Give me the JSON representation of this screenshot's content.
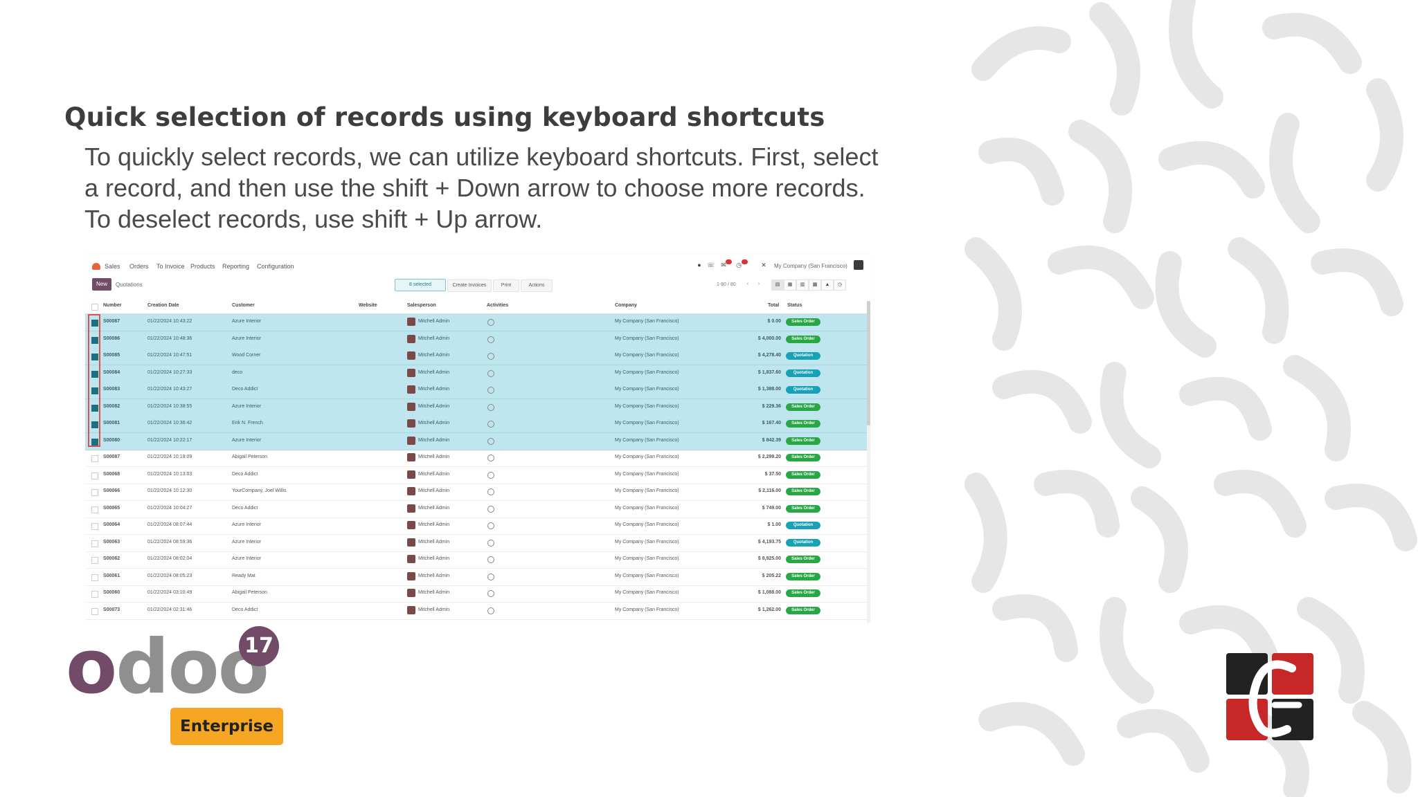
{
  "slide": {
    "title": "Quick selection of records using keyboard shortcuts",
    "body_lines": [
      "To quickly select records, we can utilize keyboard shortcuts. First, select",
      "a record, and then use the shift + Down arrow to choose more records.",
      "To deselect records, use shift + Up arrow."
    ]
  },
  "app": {
    "menu": [
      "Sales",
      "Orders",
      "To Invoice",
      "Products",
      "Reporting",
      "Configuration"
    ],
    "company": "My Company (San Francisco)",
    "new_button": "New",
    "breadcrumb": "Quotations",
    "selected_chip": "8 selected",
    "actions": [
      "Create Invoices",
      "Print",
      "Actions"
    ],
    "pager": "1-80 / 80",
    "columns": [
      "Number",
      "Creation Date",
      "Customer",
      "Website",
      "Salesperson",
      "Activities",
      "Company",
      "Total",
      "Status"
    ],
    "rows": [
      {
        "number": "S00087",
        "date": "01/22/2024 10:43:22",
        "customer": "Azure Interior",
        "salesperson": "Mitchell Admin",
        "company": "My Company (San Francisco)",
        "total": "$ 0.00",
        "status": "Sales Order",
        "status_type": "so",
        "selected": true
      },
      {
        "number": "S00086",
        "date": "01/22/2024 10:48:36",
        "customer": "Azure Interior",
        "salesperson": "Mitchell Admin",
        "company": "My Company (San Francisco)",
        "total": "$ 4,000.00",
        "status": "Sales Order",
        "status_type": "so",
        "selected": true
      },
      {
        "number": "S00085",
        "date": "01/22/2024 10:47:51",
        "customer": "Wood Corner",
        "salesperson": "Mitchell Admin",
        "company": "My Company (San Francisco)",
        "total": "$ 4,278.40",
        "status": "Quotation",
        "status_type": "q",
        "selected": true
      },
      {
        "number": "S00084",
        "date": "01/22/2024 10:27:33",
        "customer": "deco",
        "salesperson": "Mitchell Admin",
        "company": "My Company (San Francisco)",
        "total": "$ 1,837.60",
        "status": "Quotation",
        "status_type": "q",
        "selected": true
      },
      {
        "number": "S00083",
        "date": "01/22/2024 10:43:27",
        "customer": "Deco Addict",
        "salesperson": "Mitchell Admin",
        "company": "My Company (San Francisco)",
        "total": "$ 1,388.00",
        "status": "Quotation",
        "status_type": "q",
        "selected": true
      },
      {
        "number": "S00082",
        "date": "01/22/2024 10:38:55",
        "customer": "Azure Interior",
        "salesperson": "Mitchell Admin",
        "company": "My Company (San Francisco)",
        "total": "$ 229.36",
        "status": "Sales Order",
        "status_type": "so",
        "selected": true
      },
      {
        "number": "S00081",
        "date": "01/22/2024 10:36:42",
        "customer": "Erik N. French",
        "salesperson": "Mitchell Admin",
        "company": "My Company (San Francisco)",
        "total": "$ 167.40",
        "status": "Sales Order",
        "status_type": "so",
        "selected": true
      },
      {
        "number": "S00080",
        "date": "01/22/2024 10:22:17",
        "customer": "Azure Interior",
        "salesperson": "Mitchell Admin",
        "company": "My Company (San Francisco)",
        "total": "$ 842.39",
        "status": "Sales Order",
        "status_type": "so",
        "selected": true
      },
      {
        "number": "S00087",
        "date": "01/22/2024 10:19:09",
        "customer": "Abigail Peterson",
        "salesperson": "Mitchell Admin",
        "company": "My Company (San Francisco)",
        "total": "$ 2,299.20",
        "status": "Sales Order",
        "status_type": "so",
        "selected": false
      },
      {
        "number": "S00068",
        "date": "01/22/2024 10:13:03",
        "customer": "Deco Addict",
        "salesperson": "Mitchell Admin",
        "company": "My Company (San Francisco)",
        "total": "$ 37.50",
        "status": "Sales Order",
        "status_type": "so",
        "selected": false
      },
      {
        "number": "S00066",
        "date": "01/22/2024 10:12:30",
        "customer": "YourCompany, Joel Willis",
        "salesperson": "Mitchell Admin",
        "company": "My Company (San Francisco)",
        "total": "$ 2,116.00",
        "status": "Sales Order",
        "status_type": "so",
        "selected": false
      },
      {
        "number": "S00065",
        "date": "01/22/2024 10:04:27",
        "customer": "Deco Addict",
        "salesperson": "Mitchell Admin",
        "company": "My Company (San Francisco)",
        "total": "$ 749.00",
        "status": "Sales Order",
        "status_type": "so",
        "selected": false
      },
      {
        "number": "S00064",
        "date": "01/22/2024 08:07:44",
        "customer": "Azure Interior",
        "salesperson": "Mitchell Admin",
        "company": "My Company (San Francisco)",
        "total": "$ 1.00",
        "status": "Quotation",
        "status_type": "q",
        "selected": false
      },
      {
        "number": "S00063",
        "date": "01/22/2024 08:59:36",
        "customer": "Azure Interior",
        "salesperson": "Mitchell Admin",
        "company": "My Company (San Francisco)",
        "total": "$ 4,193.75",
        "status": "Quotation",
        "status_type": "q",
        "selected": false
      },
      {
        "number": "S00062",
        "date": "01/22/2024 08:02:04",
        "customer": "Azure Interior",
        "salesperson": "Mitchell Admin",
        "company": "My Company (San Francisco)",
        "total": "$ 8,925.00",
        "status": "Sales Order",
        "status_type": "so",
        "selected": false
      },
      {
        "number": "S00061",
        "date": "01/22/2024 08:05:23",
        "customer": "Ready Mat",
        "salesperson": "Mitchell Admin",
        "company": "My Company (San Francisco)",
        "total": "$ 205.22",
        "status": "Sales Order",
        "status_type": "so",
        "selected": false
      },
      {
        "number": "S00060",
        "date": "01/22/2024 03:10:49",
        "customer": "Abigail Peterson",
        "salesperson": "Mitchell Admin",
        "company": "My Company (San Francisco)",
        "total": "$ 1,088.00",
        "status": "Sales Order",
        "status_type": "so",
        "selected": false
      },
      {
        "number": "S00073",
        "date": "01/22/2024 02:31:46",
        "customer": "Deco Addict",
        "salesperson": "Mitchell Admin",
        "company": "My Company (San Francisco)",
        "total": "$ 1,262.00",
        "status": "Sales Order",
        "status_type": "so",
        "selected": false
      }
    ]
  },
  "logos": {
    "odoo_o": "o",
    "odoo_rest": "doo",
    "version": "17",
    "edition": "Enterprise"
  },
  "colors": {
    "odoo_purple": "#714b67",
    "enterprise_orange": "#f5a623",
    "selected_row": "#bfe6ee",
    "highlight_red": "#d9534f"
  }
}
